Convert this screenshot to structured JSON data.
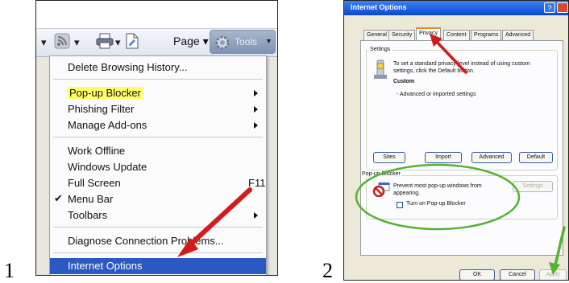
{
  "step_labels": [
    "1",
    "2"
  ],
  "toolbar": {
    "page_label": "Page",
    "tools_label": "Tools"
  },
  "menu": {
    "items": [
      {
        "label": "Delete Browsing History...",
        "submenu": false
      },
      {
        "label": "Pop-up Blocker",
        "submenu": true,
        "highlight": "#ffff66"
      },
      {
        "label": "Phishing Filter",
        "submenu": true
      },
      {
        "label": "Manage Add-ons",
        "submenu": true
      },
      {
        "label": "Work Offline",
        "submenu": false
      },
      {
        "label": "Windows Update",
        "submenu": false
      },
      {
        "label": "Full Screen",
        "shortcut": "F11",
        "submenu": false
      },
      {
        "label": "Menu Bar",
        "checked": true,
        "submenu": false
      },
      {
        "label": "Toolbars",
        "submenu": true
      },
      {
        "label": "Diagnose Connection Problems...",
        "submenu": false
      },
      {
        "label": "Internet Options",
        "selected": true,
        "submenu": false
      }
    ],
    "check_glyph": "✔",
    "selected_color": "#2b59c2"
  },
  "dialog": {
    "title": "Internet Options",
    "help_glyph": "?",
    "tabs": [
      "General",
      "Security",
      "Privacy",
      "Content",
      "Programs",
      "Advanced"
    ],
    "active_tab": "Privacy",
    "settings": {
      "group_label": "Settings",
      "description": "To set a standard privacy level instead of using custom settings, click the Default button.",
      "level": "Custom",
      "detail": "- Advanced or imported settings"
    },
    "settings_buttons": [
      "Sites",
      "Import",
      "Advanced",
      "Default"
    ],
    "popup": {
      "group_label": "Pop-up Blocker",
      "prevent_text": "Prevent most pop-up windows from appearing.",
      "settings_button": "Settings",
      "checkbox_label": "Turn on Pop-up Blocker",
      "checked": false
    },
    "footer_buttons": [
      "OK",
      "Cancel",
      "Apply"
    ]
  },
  "annotations": {
    "arrow_color": "#d01c1c",
    "circle_color": "#55b233",
    "apply_arrow_color": "#55b233"
  }
}
